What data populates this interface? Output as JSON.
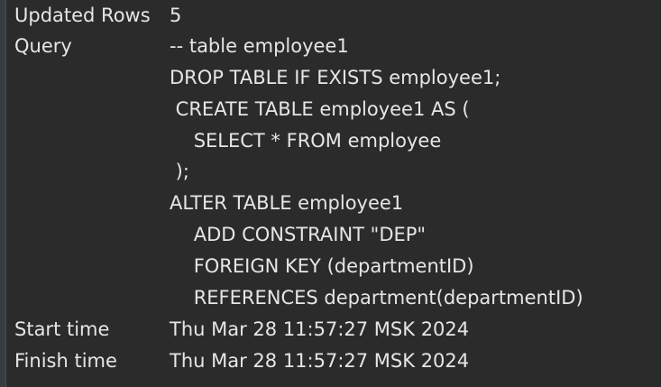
{
  "result": {
    "updated_rows": {
      "label": "Updated Rows",
      "value": "5"
    },
    "query": {
      "label": "Query",
      "lines": [
        "-- table employee1",
        "DROP TABLE IF EXISTS employee1;",
        " CREATE TABLE employee1 AS (",
        "    SELECT * FROM employee",
        " );",
        "ALTER TABLE employee1",
        "    ADD CONSTRAINT \"DEP\"",
        "    FOREIGN KEY (departmentID)",
        "    REFERENCES department(departmentID)"
      ]
    },
    "start_time": {
      "label": "Start time",
      "value": "Thu Mar 28 11:57:27 MSK 2024"
    },
    "finish_time": {
      "label": "Finish time",
      "value": "Thu Mar 28 11:57:27 MSK 2024"
    }
  }
}
